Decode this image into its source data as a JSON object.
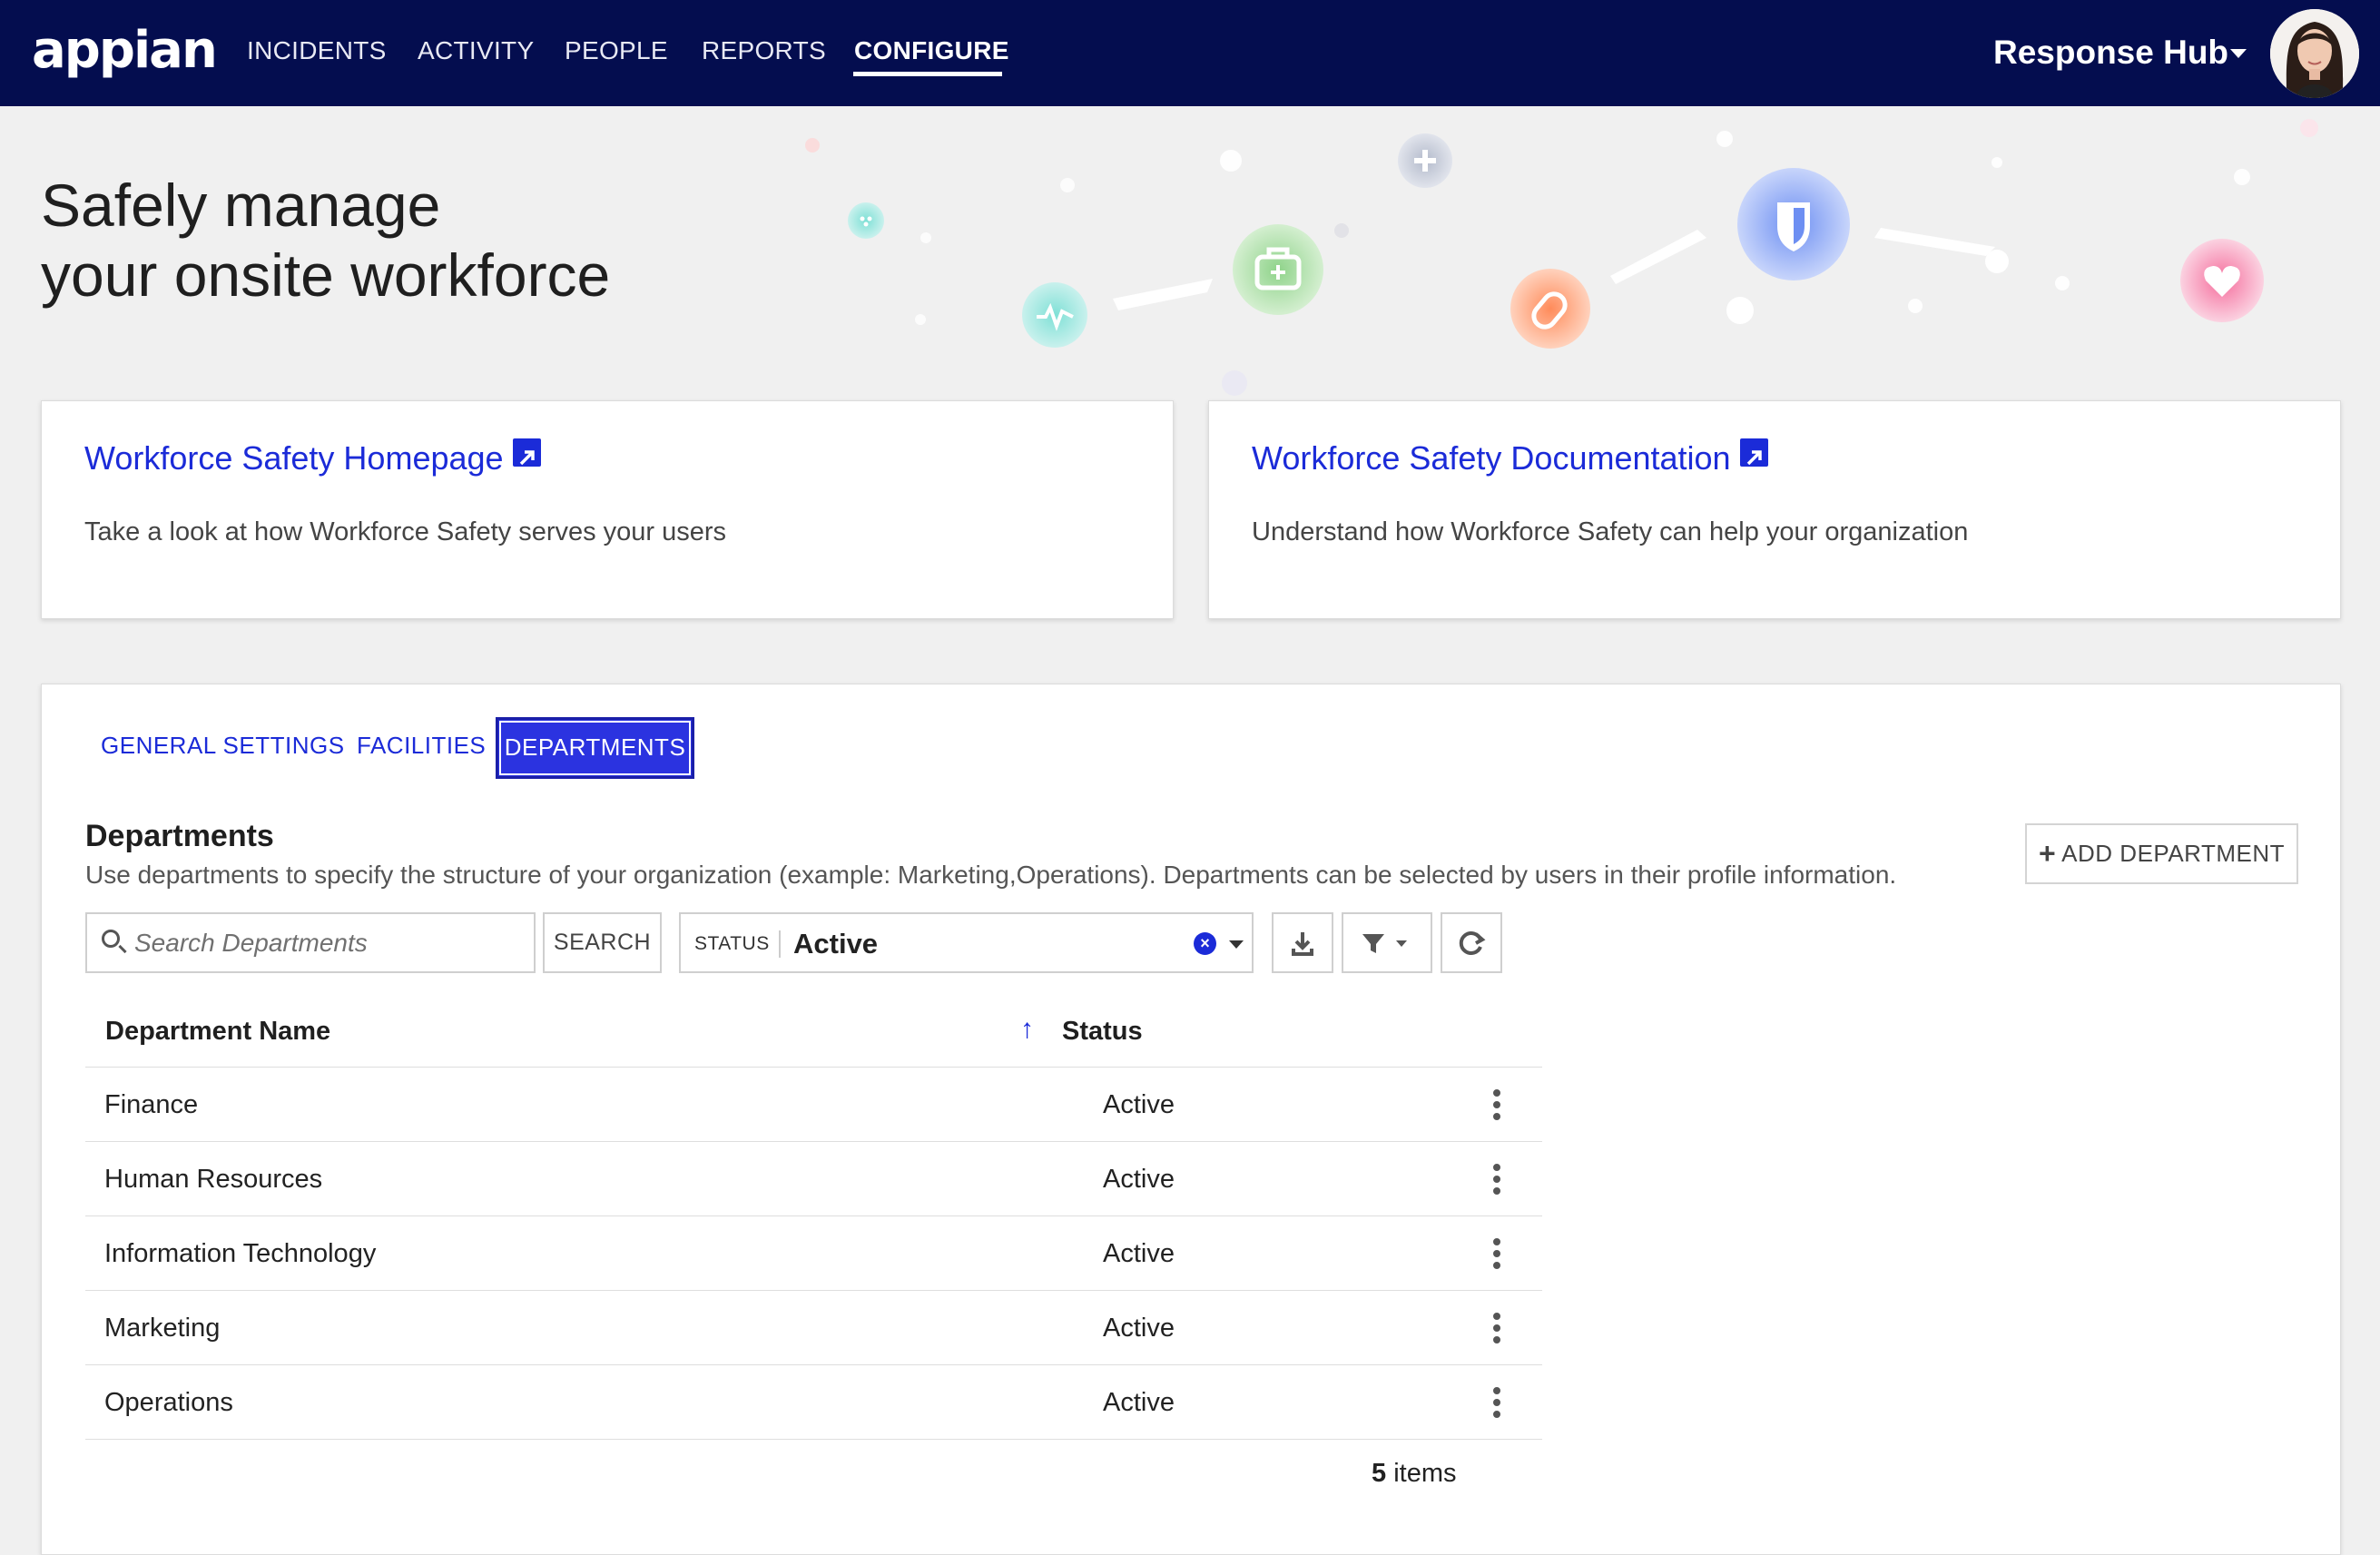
{
  "app": {
    "logo_text": "appian",
    "site_name": "Response Hub"
  },
  "nav": {
    "items": [
      {
        "label": "INCIDENTS"
      },
      {
        "label": "ACTIVITY"
      },
      {
        "label": "PEOPLE"
      },
      {
        "label": "REPORTS"
      },
      {
        "label": "CONFIGURE",
        "active": true
      }
    ]
  },
  "hero": {
    "line1": "Safely manage",
    "line2": "your onsite workforce"
  },
  "cards": [
    {
      "link": "Workforce Safety Homepage",
      "desc": "Take a look at how Workforce Safety serves your users",
      "icon": "external-link-icon"
    },
    {
      "link": "Workforce Safety Documentation",
      "desc": "Understand how Workforce Safety can help your organization",
      "icon": "external-link-icon"
    }
  ],
  "tabs": [
    {
      "label": "GENERAL SETTINGS"
    },
    {
      "label": "FACILITIES"
    },
    {
      "label": "DEPARTMENTS",
      "active": true
    }
  ],
  "section": {
    "title": "Departments",
    "description": "Use departments to specify the structure of your organization (example: Marketing,Operations). Departments can be selected by users in their profile information.",
    "add_button": "ADD DEPARTMENT"
  },
  "filters": {
    "search_placeholder": "Search Departments",
    "search_value": "",
    "search_button": "SEARCH",
    "status_label": "STATUS",
    "status_value": "Active"
  },
  "table": {
    "columns": [
      "Department Name",
      "Status"
    ],
    "sort": "ascending",
    "rows": [
      {
        "name": "Finance",
        "status": "Active"
      },
      {
        "name": "Human Resources",
        "status": "Active"
      },
      {
        "name": "Information Technology",
        "status": "Active"
      },
      {
        "name": "Marketing",
        "status": "Active"
      },
      {
        "name": "Operations",
        "status": "Active"
      }
    ],
    "count_number": "5",
    "count_suffix": "items"
  },
  "colors": {
    "nav_bg": "#040d4f",
    "accent": "#1b2bd8",
    "active_tab_bg": "#2b33e0"
  }
}
